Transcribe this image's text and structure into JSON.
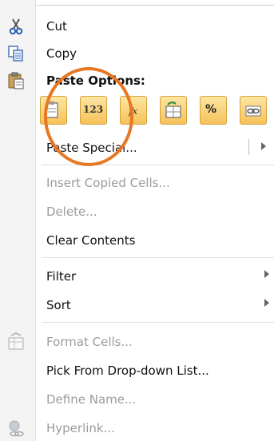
{
  "menu": {
    "cut": {
      "label": "Cut"
    },
    "copy": {
      "label": "Copy"
    },
    "paste_options": {
      "label": "Paste Options:"
    },
    "paste_buttons": [
      {
        "name": "paste",
        "text": ""
      },
      {
        "name": "values",
        "text": "123"
      },
      {
        "name": "formulas",
        "text": "fx"
      },
      {
        "name": "transpose",
        "text": ""
      },
      {
        "name": "formatting",
        "text": "%"
      },
      {
        "name": "paste-link",
        "text": ""
      }
    ],
    "paste_special": {
      "label": "Paste Special..."
    },
    "insert_copied_cells": {
      "label": "Insert Copied Cells..."
    },
    "delete": {
      "label": "Delete..."
    },
    "clear_contents": {
      "label": "Clear Contents"
    },
    "filter": {
      "label": "Filter"
    },
    "sort": {
      "label": "Sort"
    },
    "format_cells": {
      "label": "Format Cells..."
    },
    "pick_from_list": {
      "label": "Pick From Drop-down List..."
    },
    "define_name": {
      "label": "Define Name..."
    },
    "hyperlink": {
      "label": "Hyperlink..."
    }
  },
  "colors": {
    "highlight_circle": "#e87722",
    "paste_button_fill": "#f6c25a",
    "disabled_text": "#9b9b9b"
  },
  "icons": [
    "scissors-icon",
    "copy-icon",
    "clipboard-icon",
    "format-cells-icon",
    "hyperlink-icon"
  ]
}
